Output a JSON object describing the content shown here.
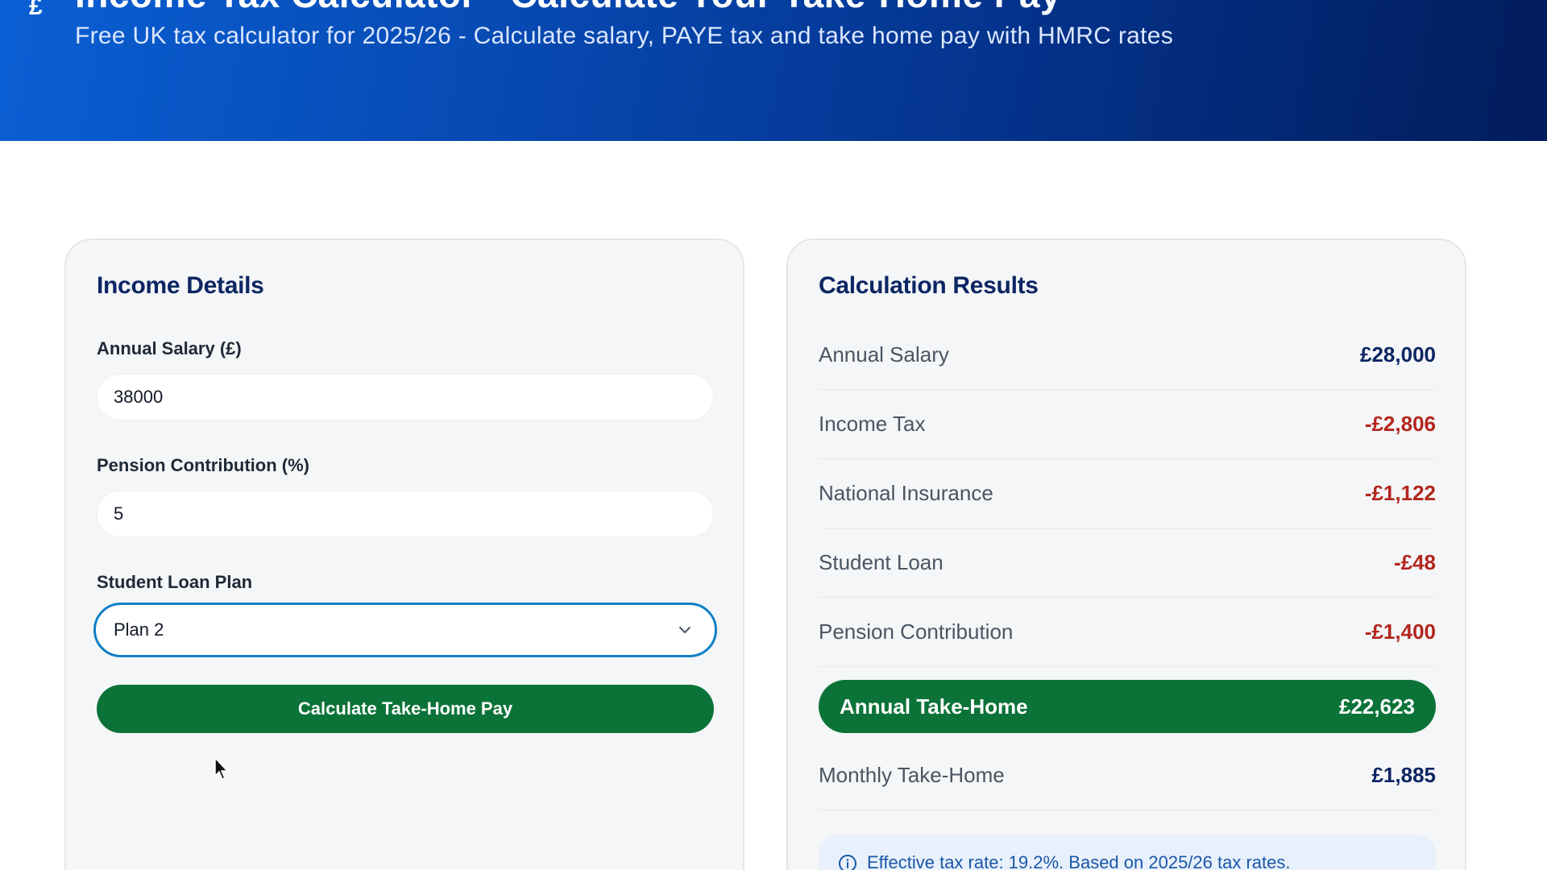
{
  "header": {
    "title": "Income Tax Calculator - Calculate Your Take-Home Pay",
    "subtitle": "Free UK tax calculator for 2025/26 - Calculate salary, PAYE tax and take home pay with HMRC rates",
    "icon": "pound-sign-icon"
  },
  "income_details": {
    "title": "Income Details",
    "salary_label": "Annual Salary (£)",
    "salary_value": "38000",
    "pension_label": "Pension Contribution (%)",
    "pension_value": "5",
    "student_loan_label": "Student Loan Plan",
    "student_loan_selected": "Plan 2",
    "calculate_button": "Calculate Take-Home Pay"
  },
  "results": {
    "title": "Calculation Results",
    "rows": [
      {
        "label": "Annual Salary",
        "value": "£28,000",
        "tone": "navy"
      },
      {
        "label": "Income Tax",
        "value": "-£2,806",
        "tone": "red"
      },
      {
        "label": "National Insurance",
        "value": "-£1,122",
        "tone": "red"
      },
      {
        "label": "Student Loan",
        "value": "-£48",
        "tone": "red"
      },
      {
        "label": "Pension Contribution",
        "value": "-£1,400",
        "tone": "red"
      }
    ],
    "annual_takehome_label": "Annual Take-Home",
    "annual_takehome_value": "£22,623",
    "monthly_takehome_label": "Monthly Take-Home",
    "monthly_takehome_value": "£1,885",
    "info_text": "Effective tax rate: 19.2%. Based on 2025/26 tax rates."
  },
  "colors": {
    "accent_green": "#0b7338",
    "heading_navy": "#0c2563",
    "deduction_red": "#b3261e",
    "focus_blue": "#0f7fc4"
  }
}
